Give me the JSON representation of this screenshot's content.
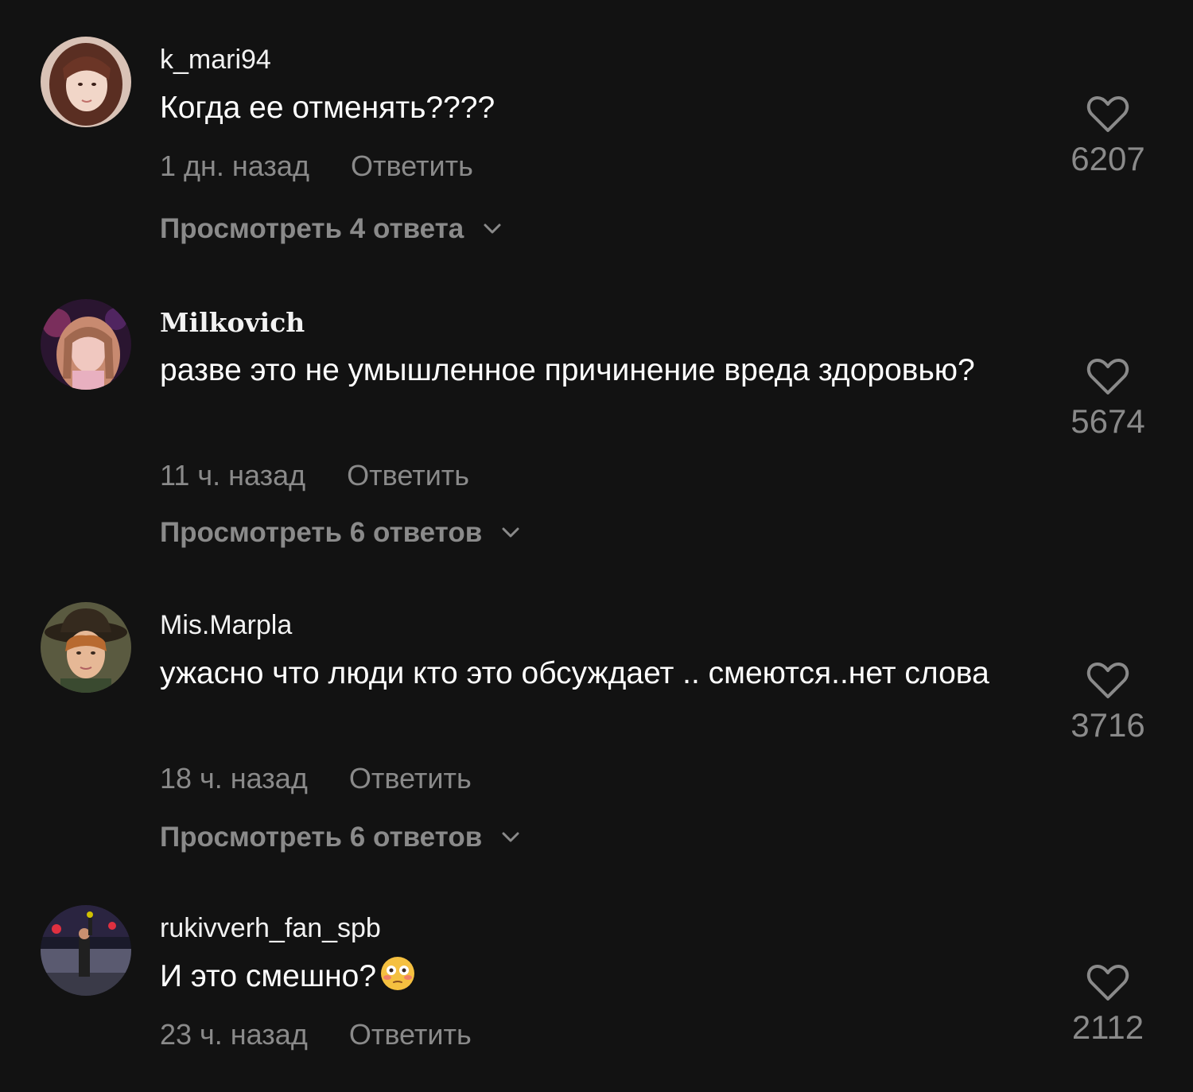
{
  "comments": [
    {
      "username": "k_mari94",
      "text": "Когда ее отменять????",
      "time": "1 дн. назад",
      "reply_label": "Ответить",
      "likes": "6207",
      "view_replies": "Просмотреть 4 ответа"
    },
    {
      "username": "Milkovich",
      "text": "разве это не умышленное причинение вреда здоровью?",
      "time": "11 ч. назад",
      "reply_label": "Ответить",
      "likes": "5674",
      "view_replies": "Просмотреть 6 ответов"
    },
    {
      "username": "Mis.Marpla",
      "text": "ужасно что люди кто это обсуждает .. смеются..нет слова",
      "time": "18 ч. назад",
      "reply_label": "Ответить",
      "likes": "3716",
      "view_replies": "Просмотреть 6 ответов"
    },
    {
      "username": "rukivverh_fan_spb",
      "text": "И это смешно?",
      "emoji": "flushed-face-emoji",
      "time": "23 ч. назад",
      "reply_label": "Ответить",
      "likes": "2112"
    }
  ],
  "colors": {
    "background": "#121212",
    "primary_text": "#ffffff",
    "secondary_text": "#8a8a8a"
  },
  "icons": {
    "like": "heart-outline-icon",
    "expand": "chevron-down-icon"
  }
}
